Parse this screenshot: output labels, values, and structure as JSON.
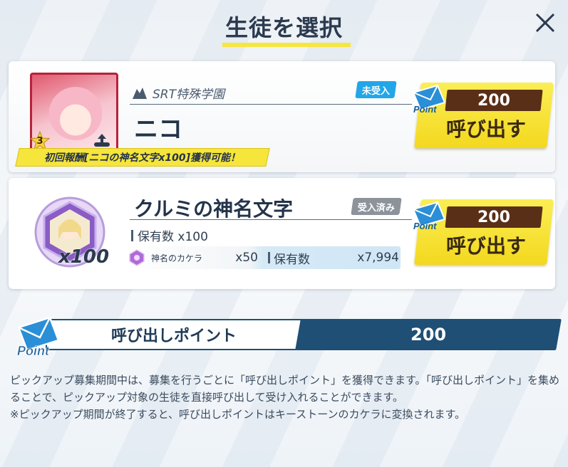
{
  "header": {
    "title": "生徒を選択",
    "close_icon": "close-icon"
  },
  "cards": [
    {
      "school": "SRT特殊学園",
      "name": "ニコ",
      "status": "未受入",
      "star_level": "3",
      "reward_banner": "初回報酬[ニコの神名文字x100]獲得可能！",
      "cost": "200",
      "call_label": "呼び出す",
      "point_badge": "Point"
    },
    {
      "item_name": "クルミの神名文字",
      "multiplier": "x100",
      "status": "受入済み",
      "owned_label": "保有数 x100",
      "material_name": "神名のカケラ",
      "material_qty": "x50",
      "material_owned_label": "保有数",
      "material_owned_value": "x7,994",
      "cost": "200",
      "call_label": "呼び出す",
      "point_badge": "Point"
    }
  ],
  "points": {
    "label": "呼び出しポイント",
    "value": "200",
    "badge": "Point"
  },
  "description": [
    "ピックアップ募集期間中は、募集を行うごとに「呼び出しポイント」を獲得できます。「呼び出しポイント」を集めることで、ピックアップ対象の生徒を直接呼び出して受け入れることができます。",
    "※ピックアップ期間が終了すると、呼び出しポイントはキーストーンのカケラに変換されます。"
  ],
  "colors": {
    "accent_yellow": "#f6e53a",
    "navy": "#1f4f75",
    "badge_blue": "#23a6e8",
    "badge_gray": "#8c939b",
    "cost_brown": "#5a2f17"
  }
}
